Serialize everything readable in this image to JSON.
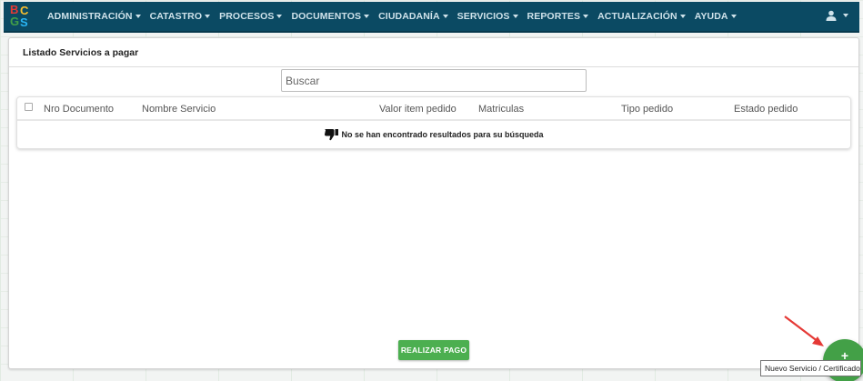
{
  "nav": {
    "logo_letters": [
      "B",
      "C",
      "G",
      "S"
    ],
    "items": [
      {
        "label": "ADMINISTRACIÓN"
      },
      {
        "label": "CATASTRO"
      },
      {
        "label": "PROCESOS"
      },
      {
        "label": "DOCUMENTOS"
      },
      {
        "label": "CIUDADANÍA"
      },
      {
        "label": "SERVICIOS"
      },
      {
        "label": "REPORTES"
      },
      {
        "label": "ACTUALIZACIÓN"
      },
      {
        "label": "AYUDA"
      }
    ],
    "user_icon": "user-icon"
  },
  "panel": {
    "title": "Listado Servicios a pagar",
    "search_placeholder": "Buscar",
    "columns": [
      "Nro Documento",
      "Nombre Servicio",
      "Valor item pedido",
      "Matriculas",
      "Tipo pedido",
      "Estado pedido"
    ],
    "empty_message": "No se han encontrado resultados para su búsqueda",
    "empty_icon": "thumbs-down-icon",
    "pay_button": "REALIZAR PAGO"
  },
  "fab": {
    "label": "+",
    "tooltip": "Nuevo Servicio / Certificado"
  },
  "colors": {
    "navbar": "#0b4a63",
    "button_green": "#4caf50",
    "arrow_red": "#e53935"
  }
}
